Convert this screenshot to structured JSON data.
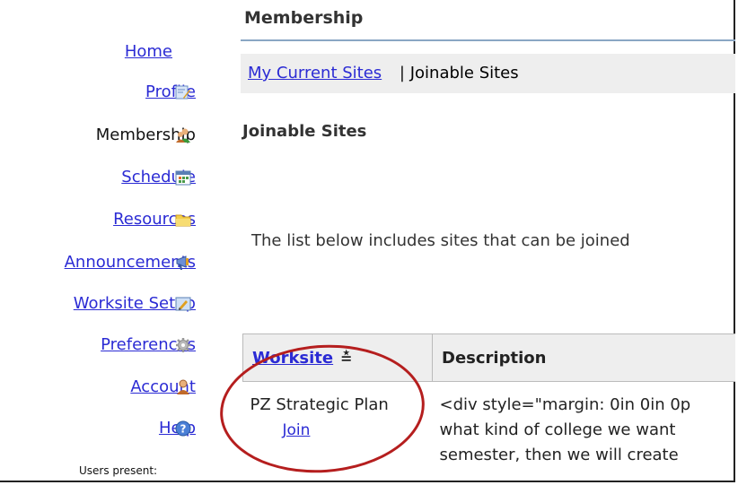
{
  "nav": {
    "items": [
      {
        "label": "Home",
        "icon": "none",
        "current": false
      },
      {
        "label": "Profile",
        "icon": "profile-icon",
        "current": false
      },
      {
        "label": "Membership",
        "icon": "membership-icon",
        "current": true
      },
      {
        "label": "Schedule",
        "icon": "calendar-icon",
        "current": false
      },
      {
        "label": "Resources",
        "icon": "folder-icon",
        "current": false
      },
      {
        "label": "Announcements",
        "icon": "megaphone-icon",
        "current": false
      },
      {
        "label": "Worksite Setup",
        "icon": "worksite-setup-icon",
        "current": false
      },
      {
        "label": "Preferences",
        "icon": "gear-icon",
        "current": false
      },
      {
        "label": "Account",
        "icon": "account-icon",
        "current": false
      },
      {
        "label": "Help",
        "icon": "help-icon",
        "current": false
      }
    ],
    "users_present": "Users present:"
  },
  "main": {
    "title": "Membership",
    "subnav": {
      "current_sites": "My Current Sites",
      "separator": "|",
      "joinable_sites": "Joinable Sites"
    },
    "heading": "Joinable Sites",
    "intro": "The list below includes sites that can be joined",
    "table": {
      "columns": [
        "Worksite",
        "Description"
      ],
      "sort_indicator": "≛",
      "rows": [
        {
          "worksite": "PZ Strategic Plan",
          "join_label": "Join",
          "description_lines": [
            "<div style=\"margin: 0in 0in 0p",
            "what kind of college we want",
            "semester, then we will create"
          ]
        }
      ]
    }
  },
  "colors": {
    "link": "#2b2bd4",
    "header_bg": "#eeeeee",
    "annotation": "#b51e1e"
  }
}
